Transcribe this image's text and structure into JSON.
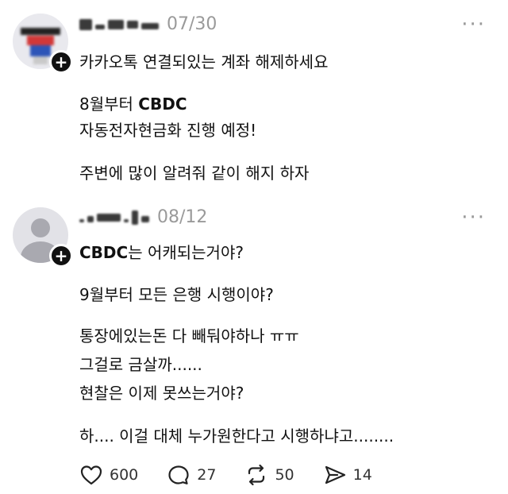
{
  "posts": [
    {
      "date": "07/30",
      "lines": {
        "l1": "카카오톡 연결되있는 계좌 해제하세요",
        "l2_prefix": "8월부터 ",
        "l2_bold": "CBDC",
        "l3": "자동전자현금화 진행 예정!",
        "l4": "주변에 많이 알려줘 같이 해지 하자"
      }
    },
    {
      "date": "08/12",
      "lines": {
        "l1_bold": "CBDC",
        "l1_rest": "는 어캐되는거야?",
        "l2": "9월부터 모든 은행 시행이야?",
        "l3": "통장에있는돈 다 빼둬야하나 ㅠㅠ",
        "l4": "그걸로 금살까......",
        "l5": "현찰은 이제 못쓰는거야?",
        "l6": "하.... 이걸 대체 누가원한다고 시행하냐고........"
      }
    }
  ],
  "more_label": "···",
  "actions": {
    "likes": "600",
    "comments": "27",
    "reposts": "50",
    "shares": "14"
  }
}
